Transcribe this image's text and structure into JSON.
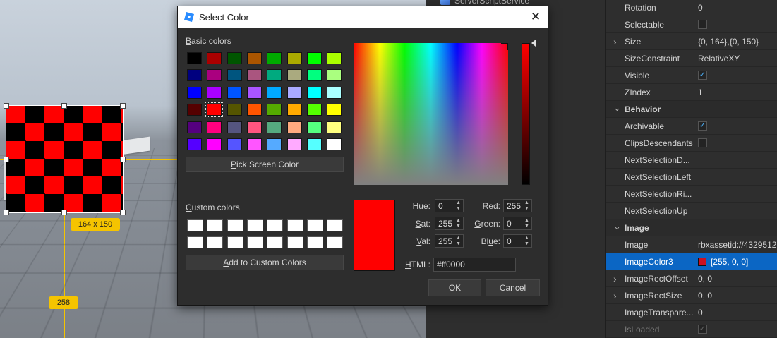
{
  "viewport": {
    "size_badge": "164 x 150",
    "distance_badge": "258"
  },
  "explorer": {
    "item_label": "ServerScriptService"
  },
  "properties": {
    "rows": [
      {
        "type": "prop",
        "name": "Rotation",
        "value": "0"
      },
      {
        "type": "prop",
        "name": "Selectable",
        "value": "",
        "checkbox": "off"
      },
      {
        "type": "prop",
        "name": "Size",
        "value": "{0, 164},{0, 150}",
        "expandable": true
      },
      {
        "type": "prop",
        "name": "SizeConstraint",
        "value": "RelativeXY"
      },
      {
        "type": "prop",
        "name": "Visible",
        "value": "",
        "checkbox": "on"
      },
      {
        "type": "prop",
        "name": "ZIndex",
        "value": "1"
      },
      {
        "type": "category",
        "name": "Behavior"
      },
      {
        "type": "prop",
        "name": "Archivable",
        "value": "",
        "checkbox": "on"
      },
      {
        "type": "prop",
        "name": "ClipsDescendants",
        "value": "",
        "checkbox": "off"
      },
      {
        "type": "prop",
        "name": "NextSelectionD...",
        "value": ""
      },
      {
        "type": "prop",
        "name": "NextSelectionLeft",
        "value": ""
      },
      {
        "type": "prop",
        "name": "NextSelectionRi...",
        "value": ""
      },
      {
        "type": "prop",
        "name": "NextSelectionUp",
        "value": ""
      },
      {
        "type": "category",
        "name": "Image"
      },
      {
        "type": "prop",
        "name": "Image",
        "value": "rbxassetid://4329512"
      },
      {
        "type": "prop",
        "name": "ImageColor3",
        "value": "[255, 0, 0]",
        "swatch": "#cc1122",
        "selected": true
      },
      {
        "type": "prop",
        "name": "ImageRectOffset",
        "value": "0, 0",
        "expandable": true
      },
      {
        "type": "prop",
        "name": "ImageRectSize",
        "value": "0, 0",
        "expandable": true
      },
      {
        "type": "prop",
        "name": "ImageTranspare...",
        "value": "0"
      },
      {
        "type": "prop",
        "name": "IsLoaded",
        "value": "",
        "checkbox": "dim",
        "dim": true
      }
    ]
  },
  "dialog": {
    "title": "Select Color",
    "close_glyph": "✕",
    "basic_colors_label_u": "B",
    "basic_colors_label_rest": "asic colors",
    "basic_colors": [
      [
        "#000000",
        "#aa0000",
        "#005500",
        "#aa5500",
        "#00aa00",
        "#aaaa00",
        "#00ff00",
        "#aaff00"
      ],
      [
        "#00007f",
        "#aa007f",
        "#00557f",
        "#aa557f",
        "#00aa7f",
        "#aaaa7f",
        "#00ff7f",
        "#aaff7f"
      ],
      [
        "#0000ff",
        "#aa00ff",
        "#0055ff",
        "#aa55ff",
        "#00aaff",
        "#aaaaff",
        "#00ffff",
        "#aaffff"
      ],
      [
        "#550000",
        "#ff0000",
        "#555500",
        "#ff5500",
        "#55aa00",
        "#ffaa00",
        "#55ff00",
        "#ffff00"
      ],
      [
        "#55007f",
        "#ff007f",
        "#55557f",
        "#ff557f",
        "#55aa7f",
        "#ffaa7f",
        "#55ff7f",
        "#ffff7f"
      ],
      [
        "#5500ff",
        "#ff00ff",
        "#5555ff",
        "#ff55ff",
        "#55aaff",
        "#ffaaff",
        "#55ffff",
        "#ffffff"
      ]
    ],
    "selected_basic": [
      3,
      1
    ],
    "pick_screen_u": "P",
    "pick_screen_rest": "ick Screen Color",
    "custom_colors_label_u": "C",
    "custom_colors_label_rest": "ustom colors",
    "add_custom_u": "A",
    "add_custom_rest": "dd to Custom Colors",
    "fields": {
      "hue": {
        "label_u": "u",
        "label_pre": "H",
        "label_post": "e:",
        "value": "0"
      },
      "sat": {
        "label_u": "S",
        "label_pre": "",
        "label_post": "at:",
        "value": "255"
      },
      "val": {
        "label_u": "V",
        "label_pre": "",
        "label_post": "al:",
        "value": "255"
      },
      "red": {
        "label_u": "R",
        "label_pre": "",
        "label_post": "ed:",
        "value": "255"
      },
      "green": {
        "label_u": "G",
        "label_pre": "",
        "label_post": "reen:",
        "value": "0"
      },
      "blue": {
        "label_u": "u",
        "label_pre": "Bl",
        "label_post": "e:",
        "value": "0"
      }
    },
    "html_label_u": "H",
    "html_label_rest": "TML:",
    "html_value": "#ff0000",
    "preview_color": "#ff0000",
    "ok_label": "OK",
    "cancel_label": "Cancel"
  }
}
